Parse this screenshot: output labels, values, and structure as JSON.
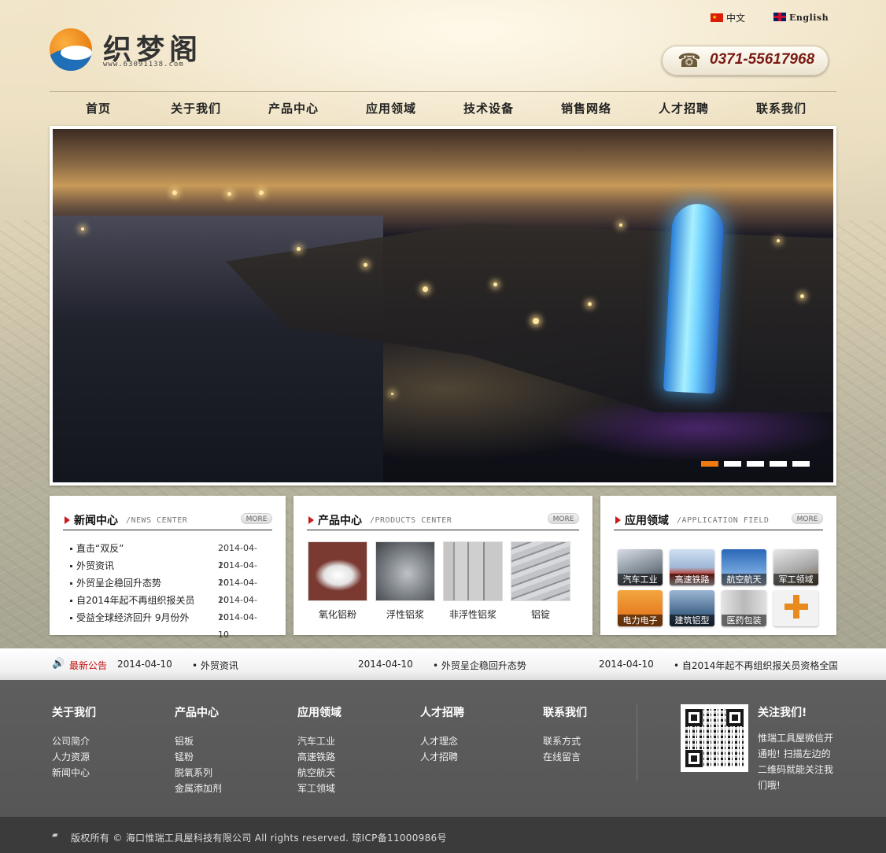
{
  "header": {
    "logo_text": "织梦阁",
    "logo_url": "www.63091138.com",
    "lang_cn": "中文",
    "lang_en": "English",
    "phone": "0371-55617968"
  },
  "nav": [
    "首页",
    "关于我们",
    "产品中心",
    "应用领域",
    "技术设备",
    "销售网络",
    "人才招聘",
    "联系我们"
  ],
  "banner": {
    "slide_count": 5,
    "active_slide": 1
  },
  "news": {
    "title": "新闻中心",
    "sub": "/NEWS CENTER",
    "more": "MORE",
    "items": [
      {
        "title": "直击“双反”",
        "date": "2014-04-10"
      },
      {
        "title": "外贸资讯",
        "date": "2014-04-10"
      },
      {
        "title": "外贸呈企稳回升态势",
        "date": "2014-04-10"
      },
      {
        "title": "自2014年起不再组织报关员",
        "date": "2014-04-10"
      },
      {
        "title": "受益全球经济回升 9月份外",
        "date": "2014-04-10"
      }
    ]
  },
  "products": {
    "title": "产品中心",
    "sub": "/PRODUCTS CENTER",
    "more": "MORE",
    "items": [
      "氧化铝粉",
      "浮性铝浆",
      "非浮性铝浆",
      "铝锭"
    ]
  },
  "applications": {
    "title": "应用领域",
    "sub": "/APPLICATION FIELD",
    "more": "MORE",
    "items": [
      "汽车工业",
      "高速铁路",
      "航空航天",
      "军工领域",
      "电力电子",
      "建筑铝型",
      "医药包装"
    ]
  },
  "notice": {
    "label": "最新公告",
    "items": [
      {
        "date": "2014-04-10",
        "title": "• 外贸资讯"
      },
      {
        "date": "2014-04-10",
        "title": "• 外贸呈企稳回升态势"
      },
      {
        "date": "2014-04-10",
        "title": "• 自2014年起不再组织报关员资格全国统一考试"
      }
    ]
  },
  "footer": {
    "columns": [
      {
        "title": "关于我们",
        "links": [
          "公司简介",
          "人力资源",
          "新闻中心"
        ]
      },
      {
        "title": "产品中心",
        "links": [
          "铝板",
          "锰粉",
          "脱氧系列",
          "金属添加剂"
        ]
      },
      {
        "title": "应用领域",
        "links": [
          "汽车工业",
          "高速铁路",
          "航空航天",
          "军工领域"
        ]
      },
      {
        "title": "人才招聘",
        "links": [
          "人才理念",
          "人才招聘"
        ]
      },
      {
        "title": "联系我们",
        "links": [
          "联系方式",
          "在线留言"
        ]
      }
    ],
    "follow_title": "关注我们!",
    "follow_text": "惟瑞工具屋微信开通啦! 扫描左边的二维码就能关注我们哦!"
  },
  "copyright": "版权所有 © 海口惟瑞工具屋科技有限公司 All rights reserved. 琼ICP备11000986号",
  "colors": {
    "accent": "#ef7a10",
    "notice_red": "#c41212",
    "footer_bg": "#5e5e5e"
  }
}
